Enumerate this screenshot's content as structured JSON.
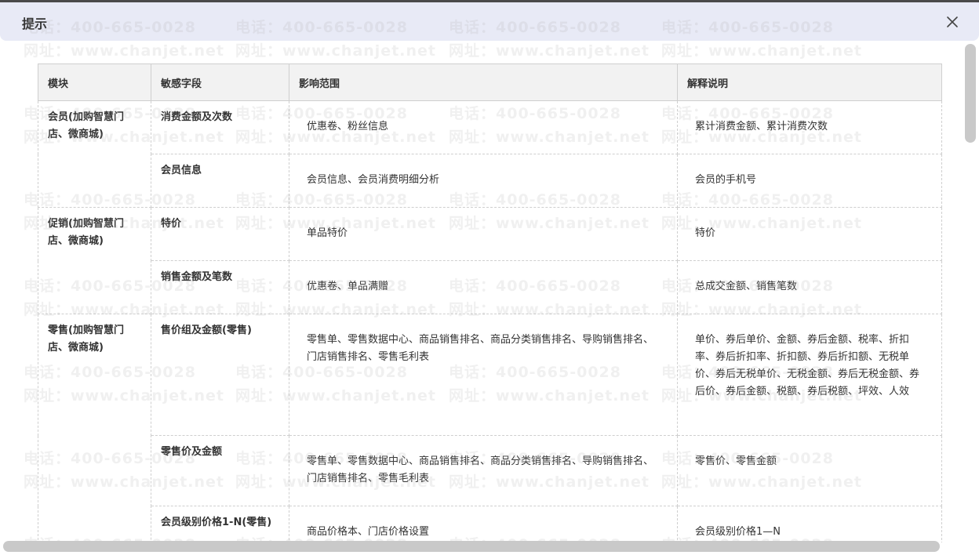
{
  "dialog": {
    "title": "提示"
  },
  "table": {
    "headers": [
      "模块",
      "敏感字段",
      "影响范围",
      "解释说明"
    ],
    "groups": [
      {
        "module": "会员(加购智慧门店、微商城)",
        "rows": [
          {
            "field": "消费金额及次数",
            "scope": "优惠卷、粉丝信息",
            "explain": "累计消费金额、累计消费次数"
          },
          {
            "field": "会员信息",
            "scope": "会员信息、会员消费明细分析",
            "explain": "会员的手机号"
          }
        ]
      },
      {
        "module": "促销(加购智慧门店、微商城)",
        "rows": [
          {
            "field": "特价",
            "scope": "单品特价",
            "explain": "特价"
          },
          {
            "field": "销售金额及笔数",
            "scope": "优惠卷、单品满赠",
            "explain": "总成交金额、销售笔数"
          }
        ]
      },
      {
        "module": "零售(加购智慧门店、微商城)",
        "rows": [
          {
            "field": "售价组及金额(零售)",
            "scope": "零售单、零售数据中心、商品销售排名、商品分类销售排名、导购销售排名、门店销售排名、零售毛利表",
            "explain": "单价、券后单价、金额、券后金额、税率、折扣率、券后折扣率、折扣额、券后折扣额、无税单价、券后无税单价、无税金额、券后无税金额、券后价、券后金额、税额、券后税额、坪效、人效"
          },
          {
            "field": "零售价及金额",
            "scope": "零售单、零售数据中心、商品销售排名、商品分类销售排名、导购销售排名、门店销售排名、零售毛利表",
            "explain": "零售价、零售金额"
          },
          {
            "field": "会员级别价格1-N(零售)",
            "scope": "商品价格本、门店价格设置",
            "explain": "会员级别价格1—N"
          }
        ]
      }
    ]
  },
  "watermark": {
    "phone": "电话：400-665-0028",
    "site": "网址：www.chanjet.net"
  },
  "icons": {
    "close": "close-icon"
  }
}
